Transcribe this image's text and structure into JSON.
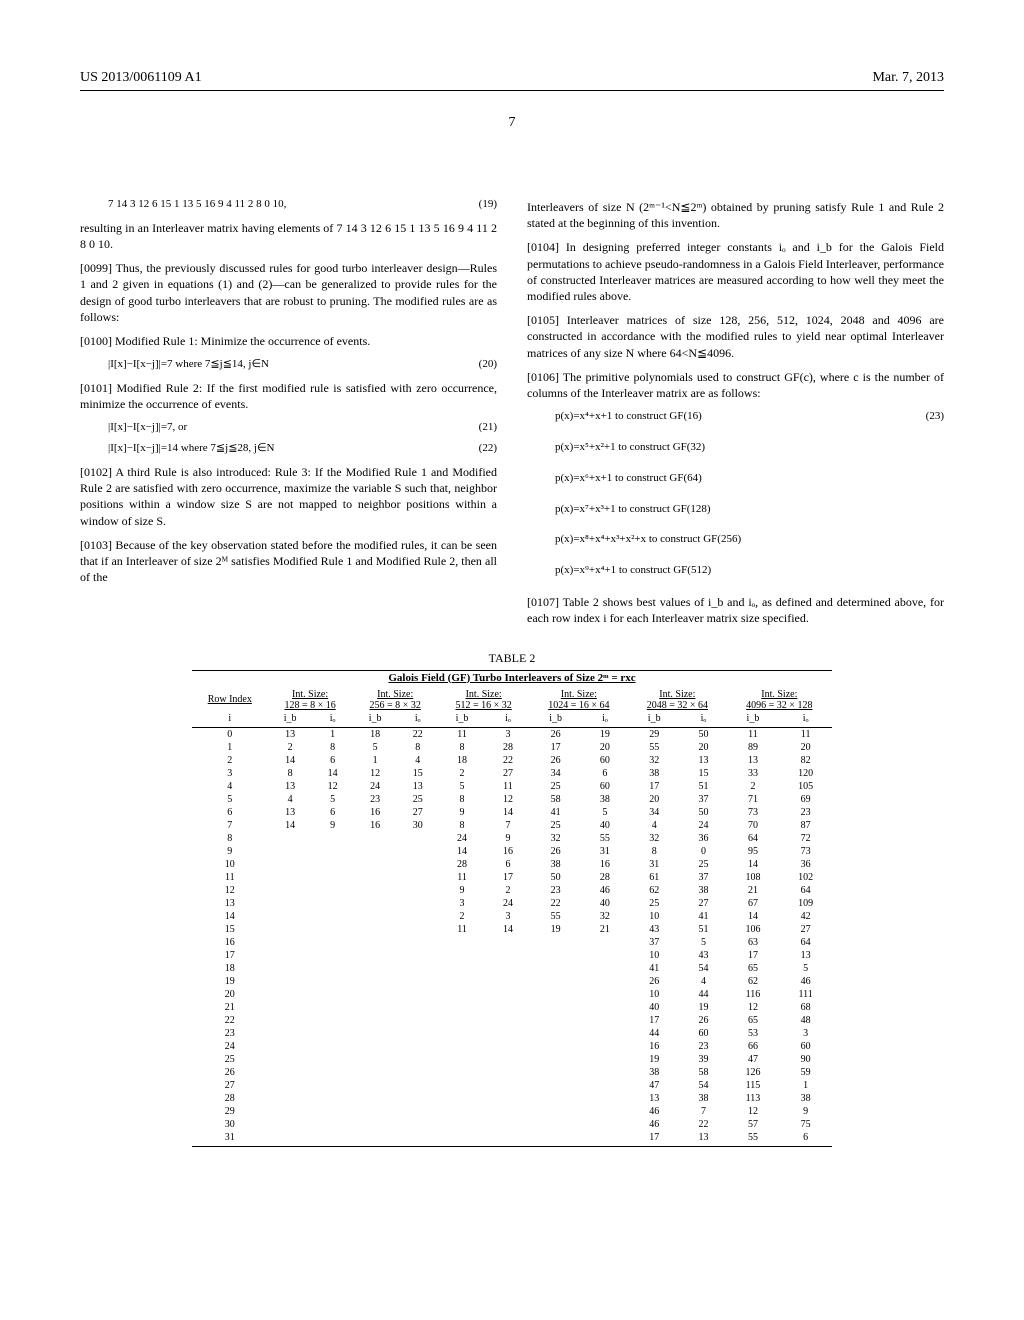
{
  "header": {
    "pub_number": "US 2013/0061109 A1",
    "date": "Mar. 7, 2013"
  },
  "page_number": "7",
  "left_col": {
    "eq19": "7 14 3 12 6 15 1 13 5 16 9 4 11 2 8 0 10,",
    "eq19_num": "(19)",
    "p1": "resulting in an Interleaver matrix having elements of 7 14 3 12 6 15 1 13 5 16 9 4 11 2 8 0 10.",
    "p0099": "[0099]   Thus, the previously discussed rules for good turbo interleaver design—Rules 1 and 2 given in equations (1) and (2)—can be generalized to provide rules for the design of good turbo interleavers that are robust to pruning. The modified rules are as follows:",
    "p0100": "[0100]   Modified Rule 1: Minimize the occurrence of events.",
    "eq20": "|I[x]−I[x−j]|=7 where 7≦j≦14, j∈N",
    "eq20_num": "(20)",
    "p0101": "[0101]   Modified Rule 2: If the first modified rule is satisfied with zero occurrence, minimize the occurrence of events.",
    "eq21": "|I[x]−I[x−j]|=7, or",
    "eq21_num": "(21)",
    "eq22": "|I[x]−I[x−j]|=14 where 7≦j≦28, j∈N",
    "eq22_num": "(22)",
    "p0102": "[0102]   A third Rule is also introduced: Rule 3: If the Modified Rule 1 and Modified Rule 2 are satisfied with zero occurrence, maximize the variable S such that, neighbor positions within a window size S are not mapped to neighbor positions within a window of size S.",
    "p0103": "[0103]   Because of the key observation stated before the modified rules, it can be seen that if an Interleaver of size 2ᴹ satisfies Modified Rule 1 and Modified Rule 2, then all of the"
  },
  "right_col": {
    "p1": "Interleavers of size N (2ᵐ⁻¹<N≦2ᵐ) obtained by pruning satisfy Rule 1 and Rule 2 stated at the beginning of this invention.",
    "p0104": "[0104]   In designing preferred integer constants iₒ and i_b for the Galois Field permutations to achieve pseudo-randomness in a Galois Field Interleaver, performance of constructed Interleaver matrices are measured according to how well they meet the modified rules above.",
    "p0105": "[0105]   Interleaver matrices of size 128, 256, 512, 1024, 2048 and 4096 are constructed in accordance with the modified rules to yield near optimal Interleaver matrices of any size N where 64<N≦4096.",
    "p0106": "[0106]   The primitive polynomials used to construct GF(c), where c is the number of columns of the Interleaver matrix are as follows:",
    "eq23": "p(x)=x⁴+x+1 to construct GF(16)",
    "eq23_num": "(23)",
    "eq_gf32": "p(x)=x⁵+x²+1 to construct GF(32)",
    "eq_gf64": "p(x)=x⁶+x+1 to construct GF(64)",
    "eq_gf128": "p(x)=x⁷+x³+1 to construct GF(128)",
    "eq_gf256": "p(x)=x⁸+x⁴+x³+x²+x to construct GF(256)",
    "eq_gf512": "p(x)=x⁹+x⁴+1 to construct GF(512)",
    "p0107": "[0107]   Table 2 shows best values of i_b and iₒ, as defined and determined above, for each row index i for each Interleaver matrix size specified."
  },
  "table": {
    "caption": "TABLE 2",
    "subcaption": "Galois Field (GF) Turbo Interleavers of Size 2ᵐ = rxc",
    "row_label": "Row Index",
    "row_sub": "i",
    "sizes": [
      {
        "title": "Int. Size:",
        "rxc": "128 = 8 × 16"
      },
      {
        "title": "Int. Size:",
        "rxc": "256 = 8 × 32"
      },
      {
        "title": "Int. Size:",
        "rxc": "512 = 16 × 32"
      },
      {
        "title": "Int. Size:",
        "rxc": "1024 = 16 × 64"
      },
      {
        "title": "Int. Size:",
        "rxc": "2048 = 32 × 64"
      },
      {
        "title": "Int. Size:",
        "rxc": "4096 = 32 × 128"
      }
    ],
    "sub_headers": [
      "i_b",
      "iₒ",
      "i_b",
      "iₒ",
      "i_b",
      "iₒ",
      "i_b",
      "iₒ",
      "i_b",
      "iₒ",
      "i_b",
      "iₒ"
    ]
  },
  "chart_data": {
    "type": "table",
    "title": "Galois Field (GF) Turbo Interleavers of Size 2^m = rxc",
    "columns": [
      "i",
      "128_ib",
      "128_io",
      "256_ib",
      "256_io",
      "512_ib",
      "512_io",
      "1024_ib",
      "1024_io",
      "2048_ib",
      "2048_io",
      "4096_ib",
      "4096_io"
    ],
    "rows": [
      [
        0,
        13,
        1,
        18,
        22,
        11,
        3,
        26,
        19,
        29,
        50,
        11,
        11
      ],
      [
        1,
        2,
        8,
        5,
        8,
        8,
        28,
        17,
        20,
        55,
        20,
        89,
        20
      ],
      [
        2,
        14,
        6,
        1,
        4,
        18,
        22,
        26,
        60,
        32,
        13,
        13,
        82
      ],
      [
        3,
        8,
        14,
        12,
        15,
        2,
        27,
        34,
        6,
        38,
        15,
        33,
        120
      ],
      [
        4,
        13,
        12,
        24,
        13,
        5,
        11,
        25,
        60,
        17,
        51,
        2,
        105
      ],
      [
        5,
        4,
        5,
        23,
        25,
        8,
        12,
        58,
        38,
        20,
        37,
        71,
        69
      ],
      [
        6,
        13,
        6,
        16,
        27,
        9,
        14,
        41,
        5,
        34,
        50,
        73,
        23
      ],
      [
        7,
        14,
        9,
        16,
        30,
        8,
        7,
        25,
        40,
        4,
        24,
        70,
        87
      ],
      [
        8,
        null,
        null,
        null,
        null,
        24,
        9,
        32,
        55,
        32,
        36,
        64,
        72
      ],
      [
        9,
        null,
        null,
        null,
        null,
        14,
        16,
        26,
        31,
        8,
        0,
        95,
        73
      ],
      [
        10,
        null,
        null,
        null,
        null,
        28,
        6,
        38,
        16,
        31,
        25,
        14,
        36
      ],
      [
        11,
        null,
        null,
        null,
        null,
        11,
        17,
        50,
        28,
        61,
        37,
        108,
        102
      ],
      [
        12,
        null,
        null,
        null,
        null,
        9,
        2,
        23,
        46,
        62,
        38,
        21,
        64
      ],
      [
        13,
        null,
        null,
        null,
        null,
        3,
        24,
        22,
        40,
        25,
        27,
        67,
        109
      ],
      [
        14,
        null,
        null,
        null,
        null,
        2,
        3,
        55,
        32,
        10,
        41,
        14,
        42
      ],
      [
        15,
        null,
        null,
        null,
        null,
        11,
        14,
        19,
        21,
        43,
        51,
        106,
        27
      ],
      [
        16,
        null,
        null,
        null,
        null,
        null,
        null,
        null,
        null,
        37,
        5,
        63,
        64
      ],
      [
        17,
        null,
        null,
        null,
        null,
        null,
        null,
        null,
        null,
        10,
        43,
        17,
        13
      ],
      [
        18,
        null,
        null,
        null,
        null,
        null,
        null,
        null,
        null,
        41,
        54,
        65,
        5
      ],
      [
        19,
        null,
        null,
        null,
        null,
        null,
        null,
        null,
        null,
        26,
        4,
        62,
        46
      ],
      [
        20,
        null,
        null,
        null,
        null,
        null,
        null,
        null,
        null,
        10,
        44,
        116,
        111
      ],
      [
        21,
        null,
        null,
        null,
        null,
        null,
        null,
        null,
        null,
        40,
        19,
        12,
        68
      ],
      [
        22,
        null,
        null,
        null,
        null,
        null,
        null,
        null,
        null,
        17,
        26,
        65,
        48
      ],
      [
        23,
        null,
        null,
        null,
        null,
        null,
        null,
        null,
        null,
        44,
        60,
        53,
        3
      ],
      [
        24,
        null,
        null,
        null,
        null,
        null,
        null,
        null,
        null,
        16,
        23,
        66,
        60
      ],
      [
        25,
        null,
        null,
        null,
        null,
        null,
        null,
        null,
        null,
        19,
        39,
        47,
        90
      ],
      [
        26,
        null,
        null,
        null,
        null,
        null,
        null,
        null,
        null,
        38,
        58,
        126,
        59
      ],
      [
        27,
        null,
        null,
        null,
        null,
        null,
        null,
        null,
        null,
        47,
        54,
        115,
        1
      ],
      [
        28,
        null,
        null,
        null,
        null,
        null,
        null,
        null,
        null,
        13,
        38,
        113,
        38
      ],
      [
        29,
        null,
        null,
        null,
        null,
        null,
        null,
        null,
        null,
        46,
        7,
        12,
        9
      ],
      [
        30,
        null,
        null,
        null,
        null,
        null,
        null,
        null,
        null,
        46,
        22,
        57,
        75
      ],
      [
        31,
        null,
        null,
        null,
        null,
        null,
        null,
        null,
        null,
        17,
        13,
        55,
        6
      ]
    ]
  }
}
